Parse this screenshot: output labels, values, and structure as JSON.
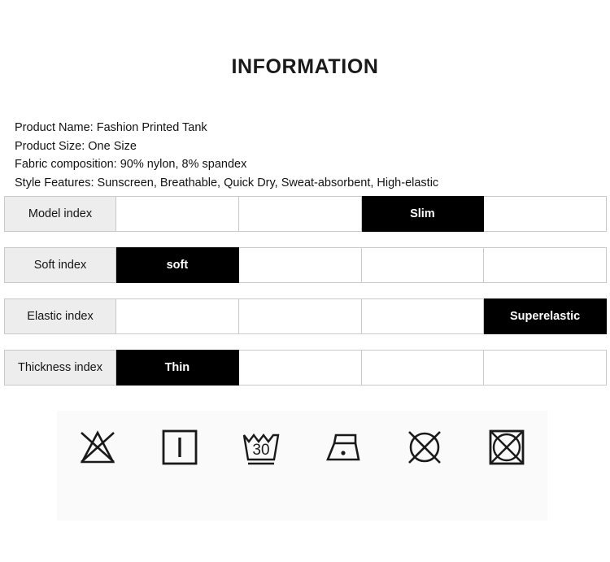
{
  "header": {
    "title": "INFORMATION"
  },
  "specs": [
    "Product Name: Fashion Printed Tank",
    "Product Size: One Size",
    "Fabric composition: 90% nylon, 8% spandex",
    "Style Features: Sunscreen, Breathable, Quick Dry, Sweat-absorbent, High-elastic"
  ],
  "indices": [
    {
      "label": "Model index",
      "segments": [
        {
          "text": "",
          "active": false
        },
        {
          "text": "",
          "active": false
        },
        {
          "text": "Slim",
          "active": true
        },
        {
          "text": "",
          "active": false
        }
      ]
    },
    {
      "label": "Soft index",
      "segments": [
        {
          "text": "soft",
          "active": true
        },
        {
          "text": "",
          "active": false
        },
        {
          "text": "",
          "active": false
        },
        {
          "text": "",
          "active": false
        }
      ]
    },
    {
      "label": "Elastic index",
      "segments": [
        {
          "text": "",
          "active": false
        },
        {
          "text": "",
          "active": false
        },
        {
          "text": "",
          "active": false
        },
        {
          "text": "Superelastic",
          "active": true
        }
      ]
    },
    {
      "label": "Thickness index",
      "segments": [
        {
          "text": "Thin",
          "active": true
        },
        {
          "text": "",
          "active": false
        },
        {
          "text": "",
          "active": false
        },
        {
          "text": "",
          "active": false
        }
      ]
    }
  ],
  "care_symbols": [
    {
      "icon": "do-not-bleach-icon",
      "label": "Do not bleach"
    },
    {
      "icon": "drip-dry-icon",
      "label": "Drip dry"
    },
    {
      "icon": "machine-wash-30-icon",
      "label": "Machine wash at 30",
      "temperature": "30"
    },
    {
      "icon": "iron-low-heat-icon",
      "label": "Iron low heat"
    },
    {
      "icon": "do-not-dry-clean-icon",
      "label": "Do not dry clean"
    },
    {
      "icon": "do-not-tumble-dry-icon",
      "label": "Do not tumble dry"
    }
  ],
  "colors": {
    "active_fill": "#000000",
    "label_fill": "#ededed",
    "border": "#c9c9c9",
    "panel_bg": "#fafafa"
  }
}
